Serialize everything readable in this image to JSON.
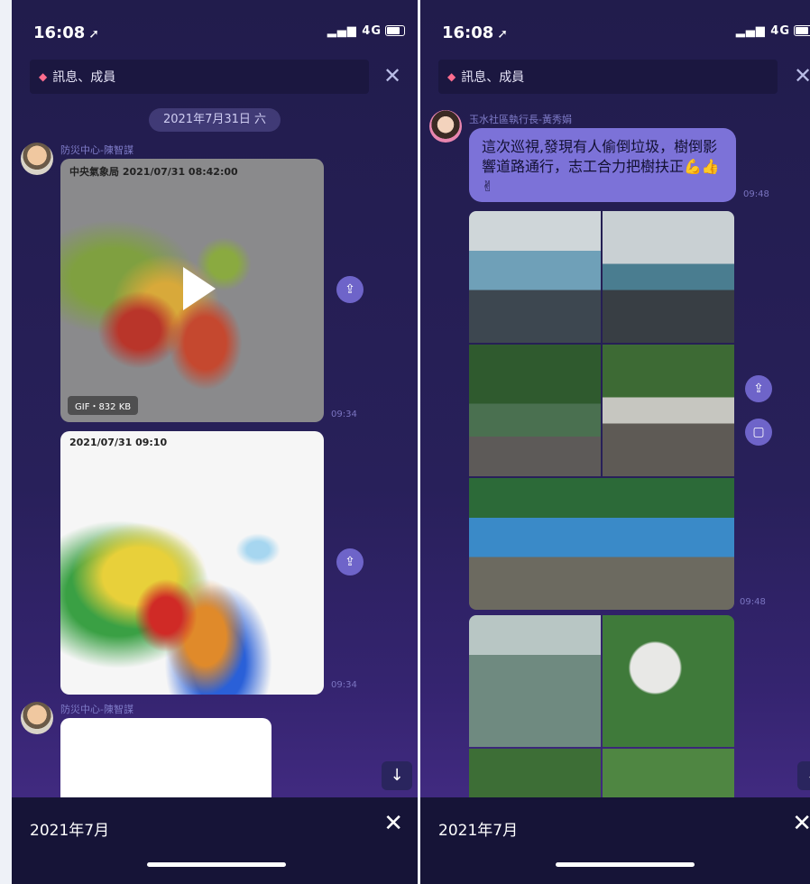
{
  "left": {
    "status": {
      "time": "16:08",
      "network": "4G"
    },
    "search_label": "訊息、成員",
    "date_divider": "2021年7月31日 六",
    "messages": [
      {
        "sender": "防災中心-陳智謀",
        "caption": "中央氣象局 2021/07/31 08:42:00",
        "badge": "GIF・832 KB",
        "time": "09:34"
      },
      {
        "caption": "2021/07/31  09:10",
        "time": "09:34"
      },
      {
        "sender": "防災中心-陳智謀"
      }
    ],
    "bottom_label": "2021年7月"
  },
  "right": {
    "status": {
      "time": "16:08",
      "network": "4G"
    },
    "search_label": "訊息、成員",
    "message": {
      "sender": "玉水社區執行長-黃秀娟",
      "text": "這次巡視,發現有人偷倒垃圾，樹倒影響道路通行，志工合力把樹扶正💪👍✌",
      "time_text": "09:48",
      "time_photos": "09:48"
    },
    "bottom_label": "2021年7月"
  },
  "icons": {
    "nav_arrow": "location-arrow-icon",
    "close": "close-icon",
    "share": "share-icon",
    "scroll_down": "arrow-down-icon"
  }
}
